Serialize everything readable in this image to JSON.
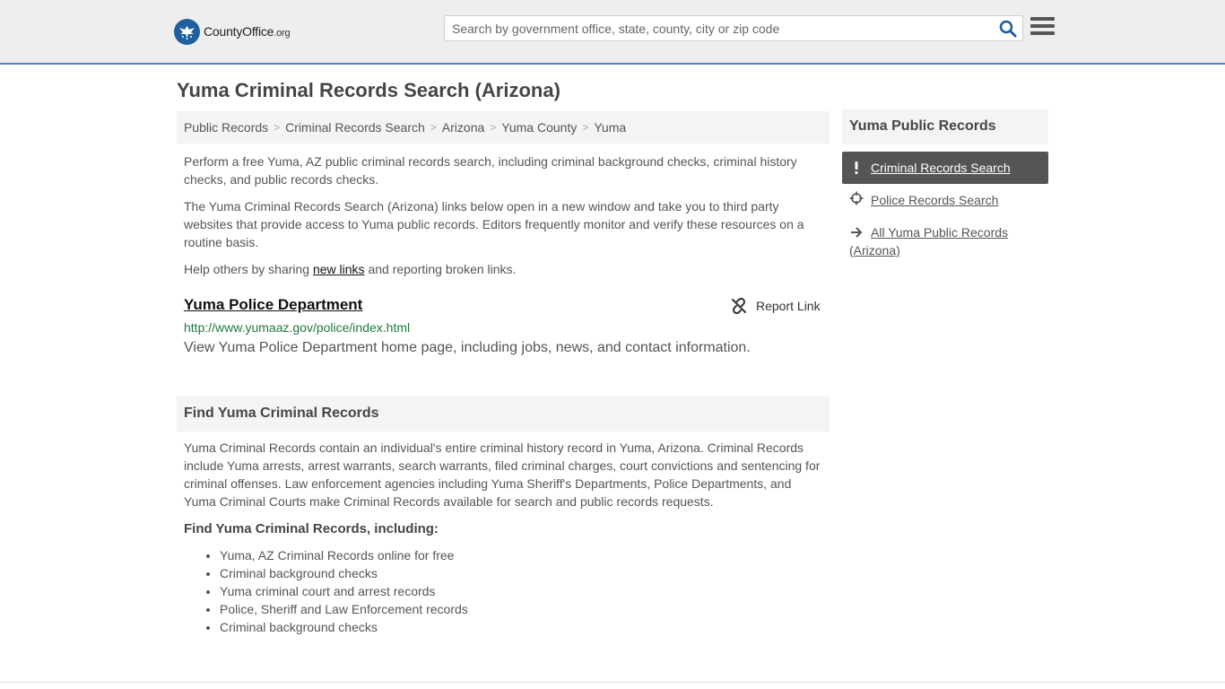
{
  "header": {
    "logo_text_main": "CountyOffice",
    "logo_text_org": ".org",
    "search_placeholder": "Search by government office, state, county, city or zip code"
  },
  "page": {
    "title": "Yuma Criminal Records Search (Arizona)"
  },
  "breadcrumb": [
    "Public Records",
    "Criminal Records Search",
    "Arizona",
    "Yuma County",
    "Yuma"
  ],
  "intro": {
    "p1": "Perform a free Yuma, AZ public criminal records search, including criminal background checks, criminal history checks, and public records checks.",
    "p2": "The Yuma Criminal Records Search (Arizona) links below open in a new window and take you to third party websites that provide access to Yuma public records. Editors frequently monitor and verify these resources on a routine basis.",
    "p3_before": "Help others by sharing ",
    "p3_link": "new links",
    "p3_after": " and reporting broken links."
  },
  "result": {
    "title": "Yuma Police Department",
    "report_label": "Report Link",
    "url": "http://www.yumaaz.gov/police/index.html",
    "description": "View Yuma Police Department home page, including jobs, news, and contact information."
  },
  "find_section": {
    "heading": "Find Yuma Criminal Records",
    "body": "Yuma Criminal Records contain an individual's entire criminal history record in Yuma, Arizona. Criminal Records include Yuma arrests, arrest warrants, search warrants, filed criminal charges, court convictions and sentencing for criminal offenses. Law enforcement agencies including Yuma Sheriff's Departments, Police Departments, and Yuma Criminal Courts make Criminal Records available for search and public records requests.",
    "subheading": "Find Yuma Criminal Records, including:",
    "items": [
      "Yuma, AZ Criminal Records online for free",
      "Criminal background checks",
      "Yuma criminal court and arrest records",
      "Police, Sheriff and Law Enforcement records",
      "Criminal background checks"
    ]
  },
  "sidebar": {
    "heading": "Yuma Public Records",
    "items": [
      {
        "label": "Criminal Records Search",
        "icon": "exclamation-icon",
        "active": true
      },
      {
        "label": "Police Records Search",
        "icon": "crosshair-icon",
        "active": false
      },
      {
        "label": "All Yuma Public Records (Arizona)",
        "icon": "arrow-right-icon",
        "active": false
      }
    ]
  },
  "colors": {
    "accent_blue": "#4a88c3",
    "logo_blue": "#1f5f9e",
    "url_green": "#1f7a3b",
    "active_bg": "#555555"
  }
}
